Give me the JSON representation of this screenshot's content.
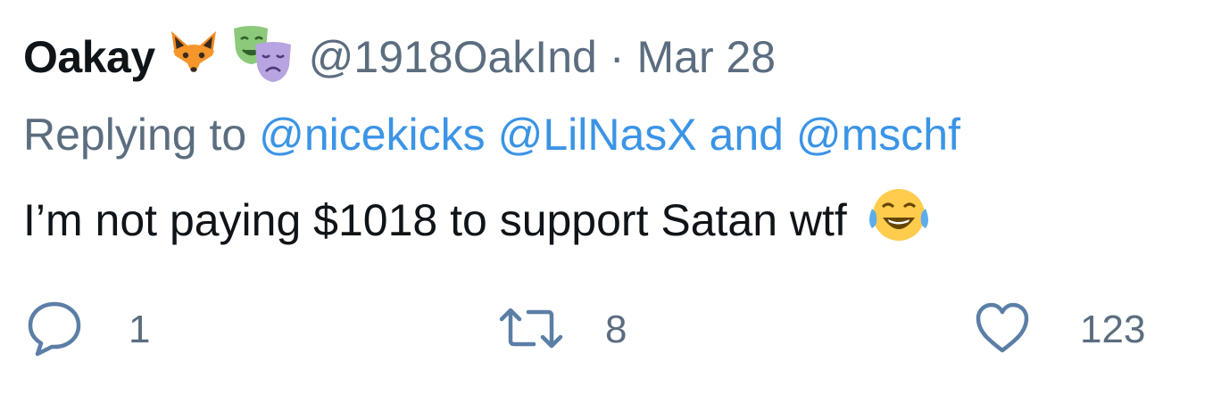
{
  "tweet": {
    "display_name": "Oakay",
    "name_emojis": [
      "fox-face-icon",
      "performing-arts-icon"
    ],
    "handle": "@1918OakInd",
    "separator": "·",
    "timestamp": "Mar 28",
    "replying_prefix": "Replying to",
    "mentions": [
      "@nicekicks",
      "@LilNasX"
    ],
    "mentions_joiner": "and",
    "last_mention": "@mschf",
    "text": "I’m not paying $1018 to support Satan wtf",
    "text_emoji": "face-with-tears-of-joy-icon",
    "actions": {
      "reply_count": "1",
      "retweet_count": "8",
      "like_count": "123"
    }
  },
  "colors": {
    "name": "#0f1419",
    "secondary": "#5b6d7f",
    "link": "#3b94e6"
  }
}
